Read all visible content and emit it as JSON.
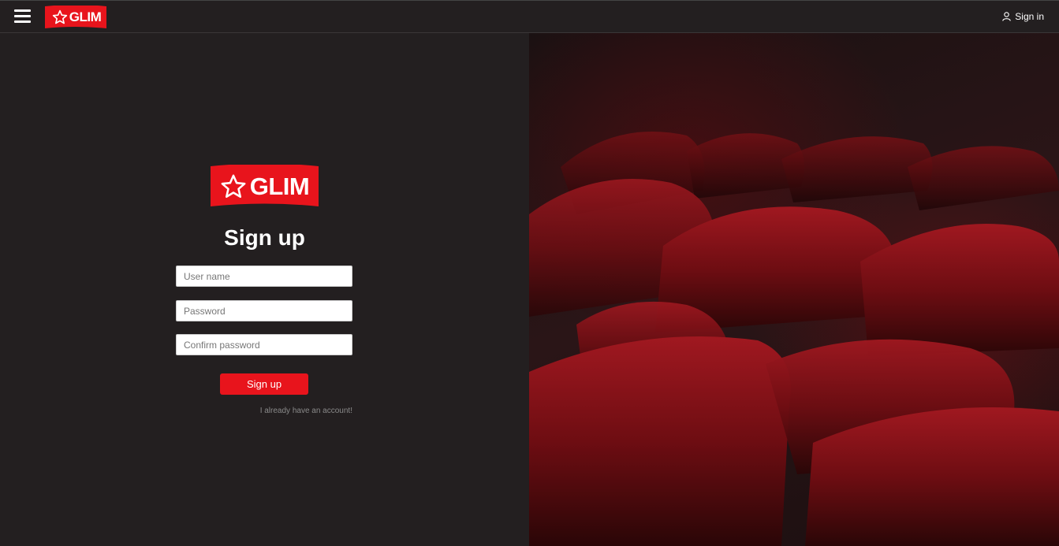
{
  "header": {
    "brand": "GLIM",
    "signin_label": "Sign in"
  },
  "form": {
    "brand": "GLIM",
    "title": "Sign up",
    "username_placeholder": "User name",
    "password_placeholder": "Password",
    "confirm_placeholder": "Confirm password",
    "submit_label": "Sign up",
    "account_link": "I already have an account!"
  },
  "icons": {
    "menu": "hamburger-menu-icon",
    "logo_star": "star-icon",
    "user": "user-icon"
  },
  "colors": {
    "background": "#231f20",
    "brand_red": "#e8141c",
    "text": "#ffffff"
  }
}
